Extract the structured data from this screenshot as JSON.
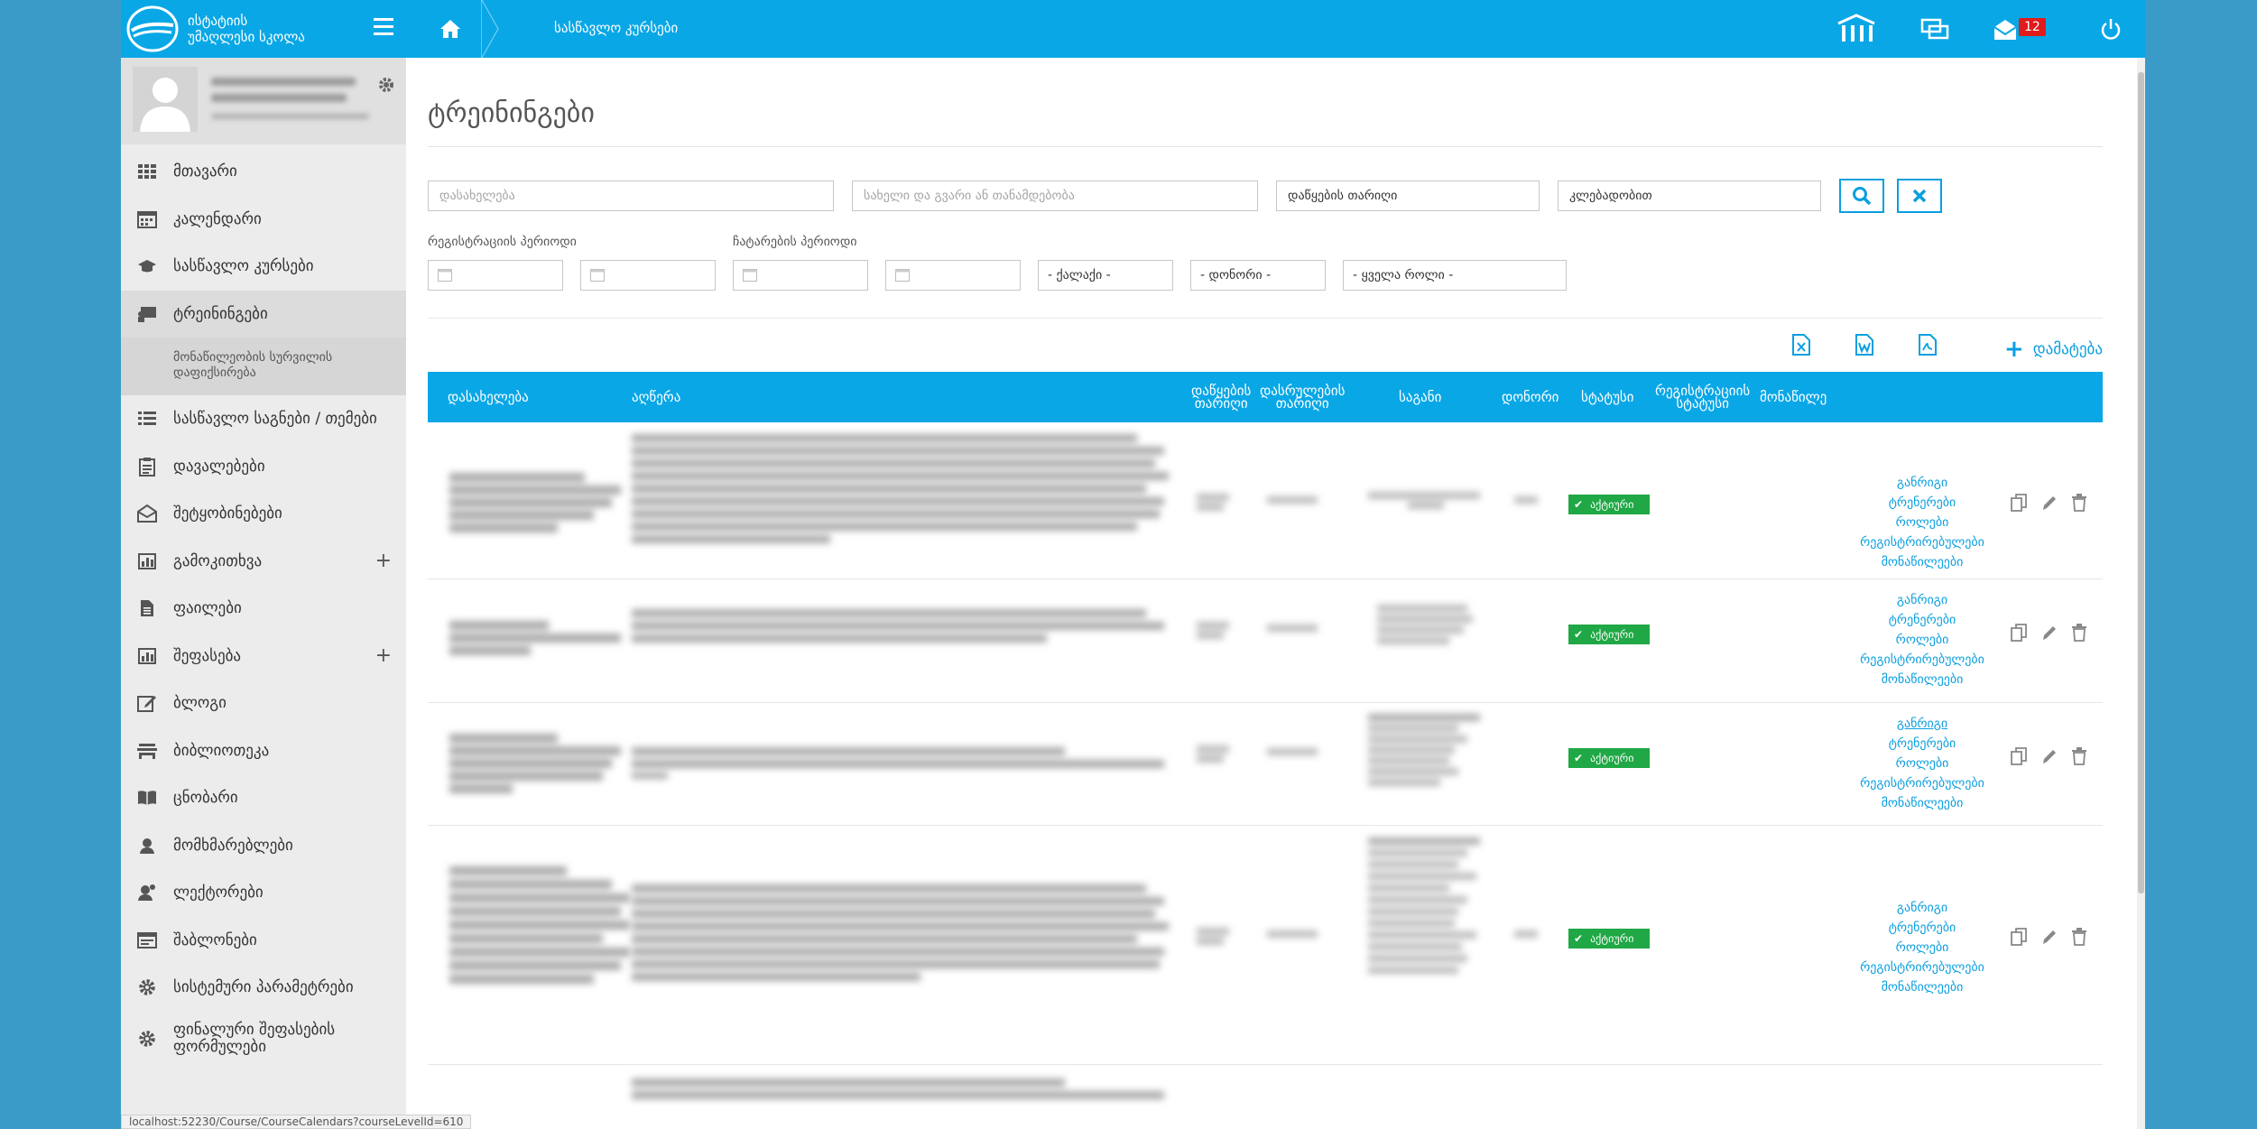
{
  "topbar": {
    "logo_line1": "ისტატიის",
    "logo_line2": "უმაღლესი სკოლა",
    "breadcrumb": "სასწავლო კურსები",
    "notif_count": "12"
  },
  "sidebar": {
    "items": [
      {
        "label": "მთავარი",
        "icon": "grid-icon"
      },
      {
        "label": "კალენდარი",
        "icon": "calendar-icon"
      },
      {
        "label": "სასწავლო კურსები",
        "icon": "graduation-cap-icon"
      },
      {
        "label": "ტრეინინგები",
        "icon": "presentation-icon",
        "active": true
      },
      {
        "label": "სასწავლო საგნები / თემები",
        "icon": "list-icon"
      },
      {
        "label": "დავალებები",
        "icon": "clipboard-icon"
      },
      {
        "label": "შეტყობინებები",
        "icon": "envelope-open-icon"
      },
      {
        "label": "გამოკითხვა",
        "icon": "bar-chart-icon",
        "expandable": true
      },
      {
        "label": "ფაილები",
        "icon": "file-icon"
      },
      {
        "label": "შეფასება",
        "icon": "bar-chart-icon",
        "expandable": true
      },
      {
        "label": "ბლოგი",
        "icon": "edit-icon"
      },
      {
        "label": "ბიბლიოთეკა",
        "icon": "library-icon"
      },
      {
        "label": "ცნობარი",
        "icon": "book-icon"
      },
      {
        "label": "მომხმარებლები",
        "icon": "user-icon"
      },
      {
        "label": "ლექტორები",
        "icon": "lecturer-icon"
      },
      {
        "label": "შაბლონები",
        "icon": "template-icon"
      },
      {
        "label": "სისტემური პარამეტრები",
        "icon": "gear-icon"
      },
      {
        "label_1": "ფინალური შეფასების",
        "label_2": "ფორმულები",
        "icon": "gear-icon"
      }
    ],
    "subitem_line1": "მონაწილეობის სურვილის",
    "subitem_line2": "დაფიქსირება"
  },
  "page": {
    "title": "ტრეინინგები"
  },
  "filters": {
    "name_placeholder": "დასახელება",
    "person_placeholder": "სახელი და გვარი ან თანამდებობა",
    "start_date_value": "დაწყების თარიღი",
    "sort_value": "კლებადობით",
    "registration_period_label": "რეგისტრაციის პერიოდი",
    "holding_period_label": "ჩატარების პერიოდი",
    "city_select": "- ქალაქი -",
    "donor_select": "- დონორი -",
    "role_select": "- ყველა როლი -"
  },
  "toolbar": {
    "add_label": "დამატება"
  },
  "table": {
    "headers": {
      "name": "დასახელება",
      "description": "აღწერა",
      "start_date_1": "დაწყების",
      "start_date_2": "თარიღი",
      "end_date_1": "დასრულების",
      "end_date_2": "თარიღი",
      "subject": "საგანი",
      "donor": "დონორი",
      "status": "სტატუსი",
      "reg_status_1": "რეგისტრაციის",
      "reg_status_2": "სტატუსი",
      "participant": "მონაწილე"
    },
    "status_label": "აქტიური",
    "row_links": [
      "განრიგი",
      "ტრენერები",
      "როლები",
      "რეგისტრირებულები",
      "მონაწილეები"
    ]
  },
  "statusbar": {
    "url": "localhost:52230/Course/CourseCalendars?courseLevelId=610"
  }
}
